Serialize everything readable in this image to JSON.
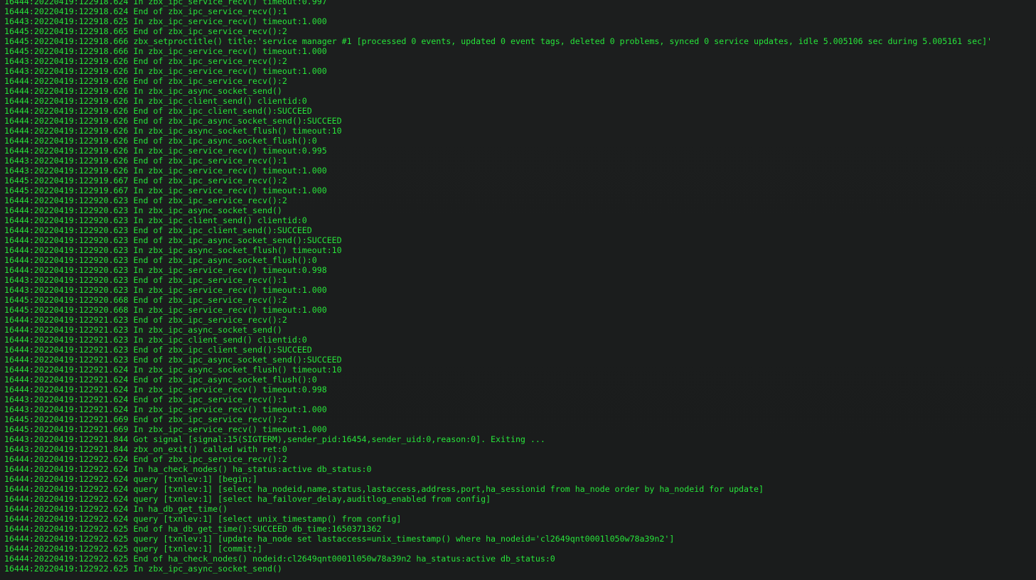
{
  "terminal": {
    "lines": [
      "16444:20220419:122918.624 In zbx_ipc_service_recv() timeout:0.997",
      "16444:20220419:122918.624 End of zbx_ipc_service_recv():1",
      "16443:20220419:122918.625 In zbx_ipc_service_recv() timeout:1.000",
      "16445:20220419:122918.665 End of zbx_ipc_service_recv():2",
      "16445:20220419:122918.666 zbx_setproctitle() title:'service manager #1 [processed 0 events, updated 0 event tags, deleted 0 problems, synced 0 service updates, idle 5.005106 sec during 5.005161 sec]'",
      "16445:20220419:122918.666 In zbx_ipc_service_recv() timeout:1.000",
      "16443:20220419:122919.626 End of zbx_ipc_service_recv():2",
      "16443:20220419:122919.626 In zbx_ipc_service_recv() timeout:1.000",
      "16444:20220419:122919.626 End of zbx_ipc_service_recv():2",
      "16444:20220419:122919.626 In zbx_ipc_async_socket_send()",
      "16444:20220419:122919.626 In zbx_ipc_client_send() clientid:0",
      "16444:20220419:122919.626 End of zbx_ipc_client_send():SUCCEED",
      "16444:20220419:122919.626 End of zbx_ipc_async_socket_send():SUCCEED",
      "16444:20220419:122919.626 In zbx_ipc_async_socket_flush() timeout:10",
      "16444:20220419:122919.626 End of zbx_ipc_async_socket_flush():0",
      "16444:20220419:122919.626 In zbx_ipc_service_recv() timeout:0.995",
      "16443:20220419:122919.626 End of zbx_ipc_service_recv():1",
      "16443:20220419:122919.626 In zbx_ipc_service_recv() timeout:1.000",
      "16445:20220419:122919.667 End of zbx_ipc_service_recv():2",
      "16445:20220419:122919.667 In zbx_ipc_service_recv() timeout:1.000",
      "16444:20220419:122920.623 End of zbx_ipc_service_recv():2",
      "16444:20220419:122920.623 In zbx_ipc_async_socket_send()",
      "16444:20220419:122920.623 In zbx_ipc_client_send() clientid:0",
      "16444:20220419:122920.623 End of zbx_ipc_client_send():SUCCEED",
      "16444:20220419:122920.623 End of zbx_ipc_async_socket_send():SUCCEED",
      "16444:20220419:122920.623 In zbx_ipc_async_socket_flush() timeout:10",
      "16444:20220419:122920.623 End of zbx_ipc_async_socket_flush():0",
      "16444:20220419:122920.623 In zbx_ipc_service_recv() timeout:0.998",
      "16443:20220419:122920.623 End of zbx_ipc_service_recv():1",
      "16443:20220419:122920.623 In zbx_ipc_service_recv() timeout:1.000",
      "16445:20220419:122920.668 End of zbx_ipc_service_recv():2",
      "16445:20220419:122920.668 In zbx_ipc_service_recv() timeout:1.000",
      "16444:20220419:122921.623 End of zbx_ipc_service_recv():2",
      "16444:20220419:122921.623 In zbx_ipc_async_socket_send()",
      "16444:20220419:122921.623 In zbx_ipc_client_send() clientid:0",
      "16444:20220419:122921.623 End of zbx_ipc_client_send():SUCCEED",
      "16444:20220419:122921.623 End of zbx_ipc_async_socket_send():SUCCEED",
      "16444:20220419:122921.624 In zbx_ipc_async_socket_flush() timeout:10",
      "16444:20220419:122921.624 End of zbx_ipc_async_socket_flush():0",
      "16444:20220419:122921.624 In zbx_ipc_service_recv() timeout:0.998",
      "16443:20220419:122921.624 End of zbx_ipc_service_recv():1",
      "16443:20220419:122921.624 In zbx_ipc_service_recv() timeout:1.000",
      "16445:20220419:122921.669 End of zbx_ipc_service_recv():2",
      "16445:20220419:122921.669 In zbx_ipc_service_recv() timeout:1.000",
      "16443:20220419:122921.844 Got signal [signal:15(SIGTERM),sender_pid:16454,sender_uid:0,reason:0]. Exiting ...",
      "16443:20220419:122921.844 zbx_on_exit() called with ret:0",
      "16444:20220419:122922.624 End of zbx_ipc_service_recv():2",
      "16444:20220419:122922.624 In ha_check_nodes() ha_status:active db_status:0",
      "16444:20220419:122922.624 query [txnlev:1] [begin;]",
      "16444:20220419:122922.624 query [txnlev:1] [select ha_nodeid,name,status,lastaccess,address,port,ha_sessionid from ha_node order by ha_nodeid for update]",
      "16444:20220419:122922.624 query [txnlev:1] [select ha_failover_delay,auditlog_enabled from config]",
      "16444:20220419:122922.624 In ha_db_get_time()",
      "16444:20220419:122922.624 query [txnlev:1] [select unix_timestamp() from config]",
      "16444:20220419:122922.625 End of ha_db_get_time():SUCCEED db_time:1650371362",
      "16444:20220419:122922.625 query [txnlev:1] [update ha_node set lastaccess=unix_timestamp() where ha_nodeid='cl2649qnt0001l050w78a39n2']",
      "16444:20220419:122922.625 query [txnlev:1] [commit;]",
      "16444:20220419:122922.625 End of ha_check_nodes() nodeid:cl2649qnt0001l050w78a39n2 ha_status:active db_status:0",
      "16444:20220419:122922.625 In zbx_ipc_async_socket_send()"
    ]
  },
  "colors": {
    "background": "#1b1d1d",
    "text": "#27e43a"
  }
}
